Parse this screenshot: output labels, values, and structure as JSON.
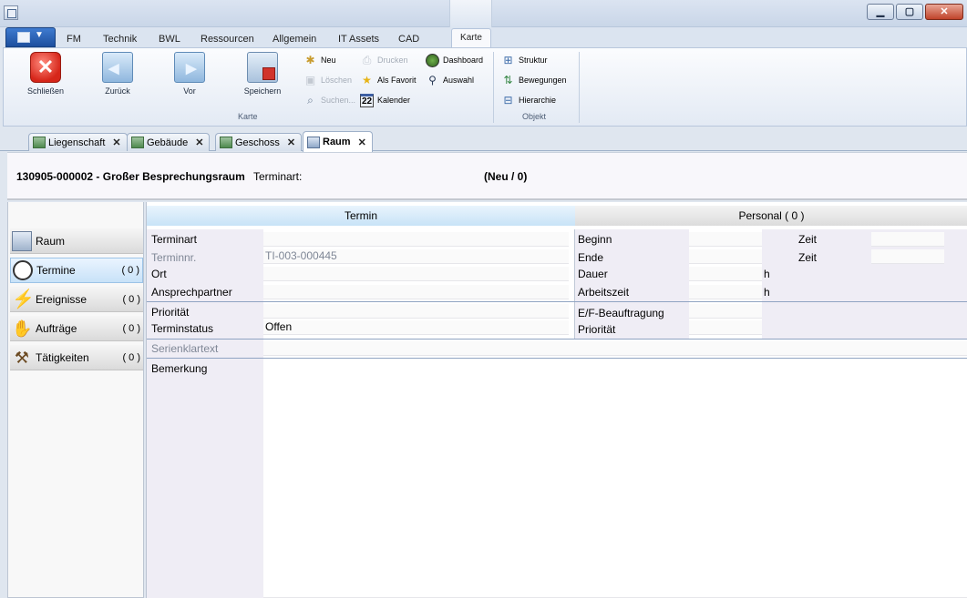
{
  "ribbon_tabs": [
    "FM",
    "Technik",
    "BWL",
    "Ressourcen",
    "Allgemein",
    "IT Assets",
    "CAD"
  ],
  "context_tab": "Karte",
  "karte_group": {
    "label": "Karte",
    "close": "Schließen",
    "back": "Zurück",
    "forward": "Vor",
    "save": "Speichern",
    "new": "Neu",
    "delete": "Löschen",
    "search": "Suchen...",
    "print": "Drucken",
    "favorite": "Als Favorit",
    "calendar": "Kalender",
    "calendar_day": "22",
    "dashboard": "Dashboard",
    "selection": "Auswahl"
  },
  "objekt_group": {
    "label": "Objekt",
    "structure": "Struktur",
    "movements": "Bewegungen",
    "hierarchy": "Hierarchie"
  },
  "doc_tabs": [
    {
      "label": "Liegenschaft"
    },
    {
      "label": "Gebäude"
    },
    {
      "label": "Geschoss"
    },
    {
      "label": "Raum"
    }
  ],
  "record": {
    "id_title": "130905-000002 - Großer Besprechungsraum",
    "type_label": "Terminart:",
    "status": "(Neu / 0)"
  },
  "nav": [
    {
      "label": "Raum",
      "count": ""
    },
    {
      "label": "Termine",
      "count": "( 0 )"
    },
    {
      "label": "Ereignisse",
      "count": "( 0 )"
    },
    {
      "label": "Aufträge",
      "count": "( 0 )"
    },
    {
      "label": "Tätigkeiten",
      "count": "( 0 )"
    }
  ],
  "section_tabs": {
    "termin": "Termin",
    "personal": "Personal ( 0 )"
  },
  "form": {
    "terminart": "Terminart",
    "terminnr_label": "Terminnr.",
    "terminnr_value": "TI-003-000445",
    "ort": "Ort",
    "ansprechpartner": "Ansprechpartner",
    "prioritaet": "Priorität",
    "terminstatus": "Terminstatus",
    "terminstatus_value": "Offen",
    "serienklartext": "Serienklartext",
    "bemerkung": "Bemerkung",
    "beginn": "Beginn",
    "ende": "Ende",
    "dauer": "Dauer",
    "arbeitszeit": "Arbeitszeit",
    "zeit1": "Zeit",
    "zeit2": "Zeit",
    "h1": "h",
    "h2": "h",
    "ef_beauftragung": "E/F-Beauftragung",
    "prioritaet2": "Priorität"
  }
}
